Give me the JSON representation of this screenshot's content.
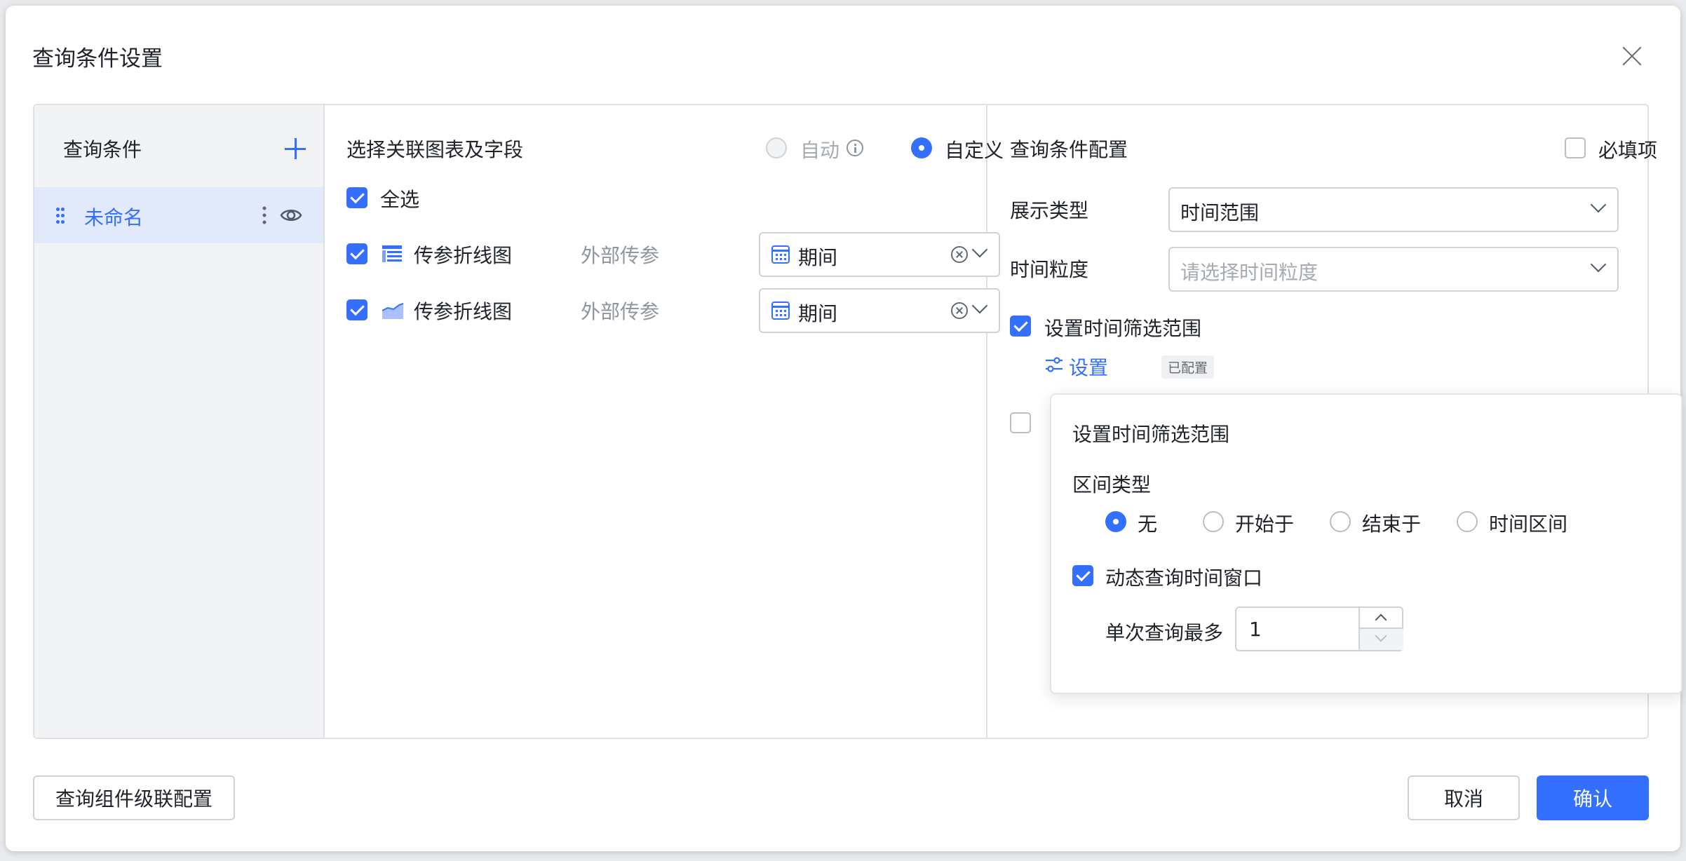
{
  "dialog": {
    "title": "查询条件设置"
  },
  "left_panel": {
    "title": "查询条件",
    "items": [
      {
        "name": "未命名"
      }
    ]
  },
  "middle_panel": {
    "title": "选择关联图表及字段",
    "mode_options": [
      {
        "label": "自动",
        "selected": false,
        "disabled": true
      },
      {
        "label": "自定义",
        "selected": true,
        "disabled": false
      }
    ],
    "select_all": {
      "label": "全选",
      "checked": true
    },
    "rows": [
      {
        "chart_name": "传参折线图",
        "icon": "table-chart-icon",
        "param_type": "外部传参",
        "field": "期间",
        "checked": true
      },
      {
        "chart_name": "传参折线图",
        "icon": "area-chart-icon",
        "param_type": "外部传参",
        "field": "期间",
        "checked": true
      }
    ]
  },
  "right_panel": {
    "title": "查询条件配置",
    "required": {
      "label": "必填项",
      "checked": false
    },
    "display_type": {
      "label": "展示类型",
      "value": "时间范围"
    },
    "time_granularity": {
      "label": "时间粒度",
      "placeholder": "请选择时间粒度"
    },
    "time_filter": {
      "label": "设置时间筛选范围",
      "checked": true
    },
    "settings_link": {
      "label": "设置",
      "tag": "已配置"
    },
    "second_option_checked": false
  },
  "popover": {
    "title": "设置时间筛选范围",
    "range_type_label": "区间类型",
    "range_options": [
      {
        "label": "无",
        "selected": true
      },
      {
        "label": "开始于",
        "selected": false
      },
      {
        "label": "结束于",
        "selected": false
      },
      {
        "label": "时间区间",
        "selected": false
      }
    ],
    "dynamic_window": {
      "label": "动态查询时间窗口",
      "checked": true
    },
    "max_per_query": {
      "label": "单次查询最多",
      "value": "1"
    }
  },
  "footer": {
    "cascade_button": "查询组件级联配置",
    "cancel_button": "取消",
    "confirm_button": "确认"
  },
  "colors": {
    "accent": "#3370ff",
    "selected_item_bg": "#e1e9fb",
    "left_panel_bg": "#f2f3f5"
  }
}
